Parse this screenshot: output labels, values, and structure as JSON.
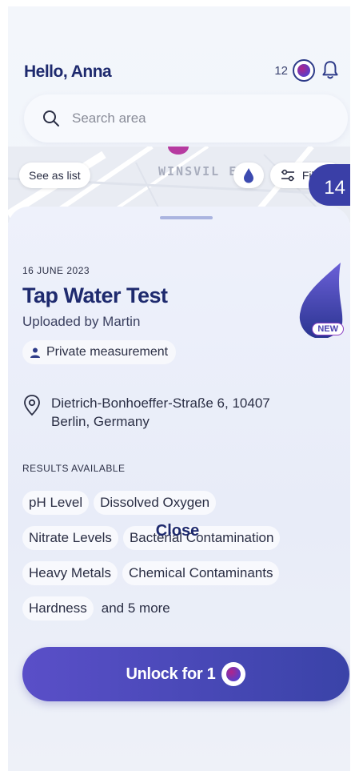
{
  "header": {
    "greeting": "Hello, Anna",
    "credits": "12"
  },
  "search": {
    "placeholder": "Search area"
  },
  "map": {
    "see_as_list": "See as list",
    "area_label": "WINSVIL  E",
    "filters": "Filters",
    "pin_count": "14"
  },
  "detail": {
    "date": "16 JUNE 2023",
    "title": "Tap Water Test",
    "uploaded_by": "Uploaded by Martin",
    "badge_new": "NEW",
    "privacy": "Private measurement",
    "address_line1": "Dietrich-Bonhoeffer-Straße 6, 10407",
    "address_line2": "Berlin, Germany",
    "results_label": "RESULTS AVAILABLE",
    "results": [
      "pH Level",
      "Dissolved Oxygen",
      "Nitrate Levels",
      "Bacterial Contamination",
      "Heavy Metals",
      "Chemical Contaminants",
      "Hardness"
    ],
    "more": "and 5 more",
    "unlock_label": "Unlock for 1",
    "close_label": "Close"
  },
  "colors": {
    "primary": "#1e2a6e",
    "button": "#4a48b8",
    "accent_pink": "#b1248b"
  },
  "icons": [
    "search-icon",
    "bell-icon",
    "credit-icon",
    "water-drop-icon",
    "filters-icon",
    "person-icon",
    "location-pin-icon"
  ]
}
